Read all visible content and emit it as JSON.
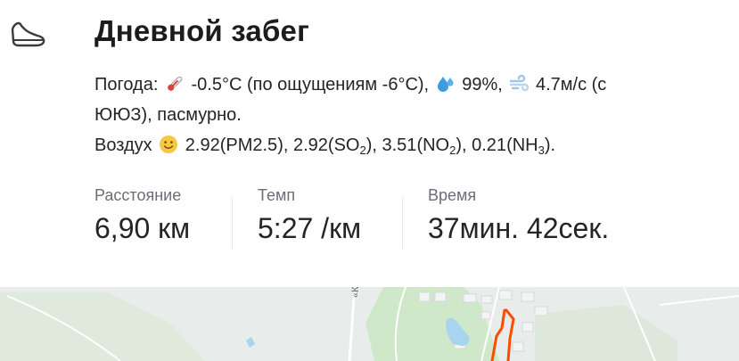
{
  "activity": {
    "icon": "running-shoe-icon",
    "title": "Дневной забег"
  },
  "weather": {
    "prefix": "Погода:",
    "temperature_icon": "thermometer-icon",
    "temperature": "-0.5°C (по ощущениям -6°C),",
    "humidity_icon": "droplets-icon",
    "humidity": "99%,",
    "wind_icon": "wind-icon",
    "wind_line1": "4.7м/с (с",
    "wind_line2": "ЮЮЗ), пасмурно."
  },
  "air": {
    "prefix": "Воздух",
    "icon": "smiling-face-icon",
    "pm25_value": "2.92",
    "pm25_label": "PM2.5",
    "so2_value": "2.92",
    "so2_label": "SO",
    "so2_sub": "2",
    "no2_value": "3.51",
    "no2_label": "NO",
    "no2_sub": "2",
    "nh3_value": "0.21",
    "nh3_label": "NH",
    "nh3_sub": "3"
  },
  "stats": [
    {
      "label": "Расстояние",
      "value": "6,90 км"
    },
    {
      "label": "Темп",
      "value": "5:27 /км"
    },
    {
      "label": "Время",
      "value": "37мин. 42сек."
    }
  ],
  "map": {
    "road_label": "«Кр",
    "route_color": "#fc4c02",
    "land_color": "#e8ecea",
    "forest_color": "#cfe8c9",
    "water_color": "#a9d4ef"
  }
}
